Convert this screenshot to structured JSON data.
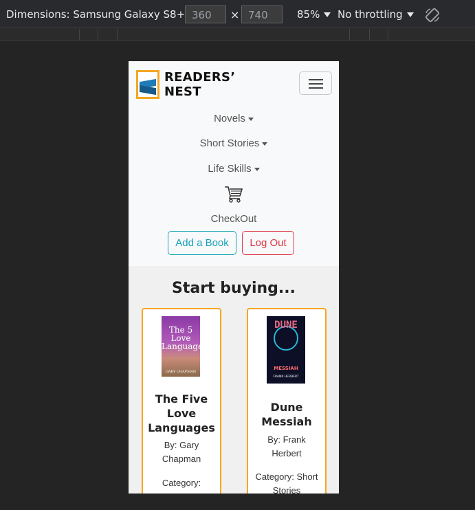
{
  "devtools": {
    "dimensions_label": "Dimensions: Samsung Galaxy S8+",
    "width": "360",
    "height": "740",
    "times": "×",
    "zoom": "85%",
    "throttling": "No throttling"
  },
  "navbar": {
    "brand_line1": "READERS’",
    "brand_line2": "NEST",
    "items": [
      {
        "label": "Novels"
      },
      {
        "label": "Short Stories"
      },
      {
        "label": "Life Skills"
      }
    ],
    "checkout_label": "CheckOut",
    "add_book_label": "Add a Book",
    "logout_label": "Log Out"
  },
  "main": {
    "heading": "Start buying...",
    "books": [
      {
        "title": "The Five Love Languages",
        "author_line": "By: Gary Chapman",
        "category_line": "Category:",
        "cover_title": "The 5 Love Languages",
        "cover_author": "GARY CHAPMAN"
      },
      {
        "title": "Dune Messiah",
        "author_line": "By: Frank Herbert",
        "category_line": "Category: Short Stories",
        "cover_title": "DUNE",
        "cover_subtitle": "MESSIAH",
        "cover_author": "FRANK HERBERT"
      }
    ]
  },
  "colors": {
    "accent_border": "#f5a623",
    "add_button": "#17a2b8",
    "logout_button": "#dc3545"
  }
}
